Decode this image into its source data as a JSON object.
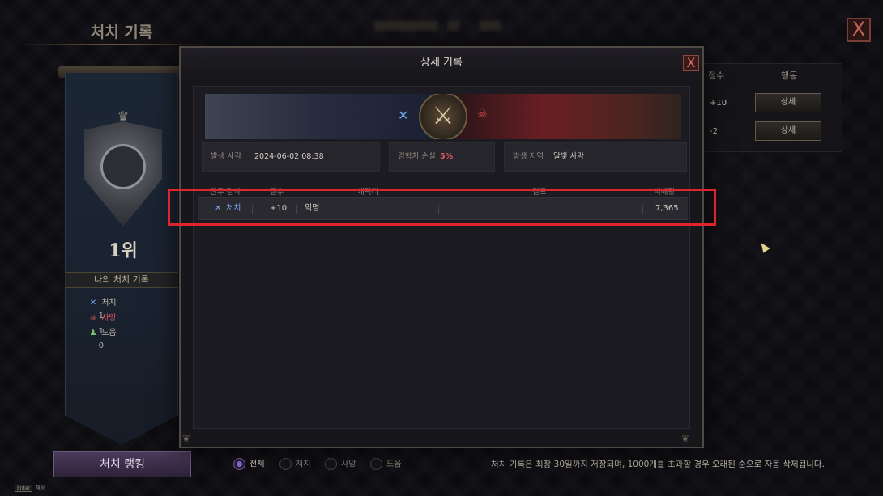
{
  "background": {
    "title": "처치 기록",
    "close_label": "X",
    "rank_label": "1위",
    "my_record_label": "나의 처치 기록",
    "stats": [
      {
        "icon": "crossed-swords-icon",
        "label": "처치",
        "value": "1",
        "color": "#79a7ee"
      },
      {
        "icon": "skull-icon",
        "label": "사망",
        "value": "1",
        "color": "#e05a5f"
      },
      {
        "icon": "helper-icon",
        "label": "도움",
        "value": "0",
        "color": "#7bbf6a"
      }
    ],
    "ranking_button": "처치 랭킹",
    "enter_key": "Enter",
    "enter_hint": "채팅",
    "right_table": {
      "col_score": "점수",
      "col_action": "행동",
      "rows": [
        {
          "score": "+10",
          "action": "상세"
        },
        {
          "score": "-2",
          "action": "상세"
        }
      ]
    },
    "filters": [
      {
        "label": "전체",
        "selected": true
      },
      {
        "label": "처치",
        "selected": false
      },
      {
        "label": "사망",
        "selected": false
      },
      {
        "label": "도움",
        "selected": false
      }
    ],
    "notice": "처치 기록은 최장 30일까지 저장되며, 1000개를 초과할 경우 오래된 순으로 자동 삭제됩니다."
  },
  "modal": {
    "title": "상세 기록",
    "close_label": "X",
    "occurred_time_label": "발생 시각",
    "occurred_time_value": "2024-06-02 08:38",
    "exp_loss_label": "경험치 손실",
    "exp_loss_value": "5%",
    "location_label": "발생 지역",
    "location_value": "달빛 사막",
    "columns": [
      "전투 결과",
      "점수",
      "캐릭터",
      "길드",
      "피해량"
    ],
    "rows": [
      {
        "result": "처치",
        "score": "+10",
        "character": "익명",
        "guild": "",
        "damage": "7,365"
      }
    ]
  },
  "colors": {
    "kill_blue": "#79a7ee",
    "death_red": "#e05a5f",
    "highlight_red": "#e0242b"
  }
}
